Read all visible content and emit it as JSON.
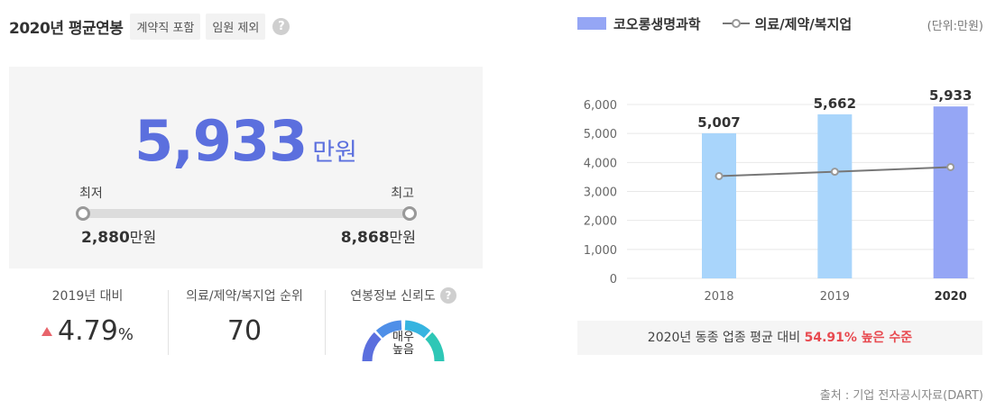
{
  "header": {
    "title": "2020년 평균연봉",
    "tags": [
      "계약직 포함",
      "임원 제외"
    ],
    "help_icon": "?"
  },
  "salary": {
    "value": "5,933",
    "unit": "만원",
    "min_label": "최저",
    "max_label": "최고",
    "min_value": "2,880",
    "max_value": "8,868",
    "value_unit": "만원"
  },
  "stats": {
    "growth_label": "2019년 대비",
    "growth_value": "4.79",
    "growth_pct": "%",
    "rank_label": "의료/제약/복지업 순위",
    "rank_value": "70",
    "reliability_label": "연봉정보 신뢰도",
    "reliability_line1": "매우",
    "reliability_line2": "높음"
  },
  "legend": {
    "company": "코오롱생명과학",
    "industry": "의료/제약/복지업",
    "unit": "(단위:만원)"
  },
  "chart_data": {
    "type": "bar",
    "categories": [
      "2018",
      "2019",
      "2020"
    ],
    "series": [
      {
        "name": "코오롱생명과학",
        "values": [
          5007,
          5662,
          5933
        ],
        "labels": [
          "5,007",
          "5,662",
          "5,933"
        ]
      },
      {
        "name": "의료/제약/복지업",
        "type": "line",
        "values": [
          3530,
          3680,
          3840
        ]
      }
    ],
    "yticks": [
      "6,000",
      "5,000",
      "4,000",
      "3,000",
      "2,000",
      "1,000",
      "0"
    ],
    "ylim": [
      0,
      6000
    ],
    "colors": {
      "bar": "#a9d5fb",
      "bar_highlight": "#95a6f5",
      "line": "#777777"
    },
    "highlight_index": 2
  },
  "compare": {
    "prefix": "2020년 동종 업종 평균 대비 ",
    "highlight": "54.91% 높은 수준"
  },
  "source": "출처 : 기업 전자공시자료(DART)",
  "colors": {
    "accent": "#5b6fde",
    "up": "#e8646b"
  }
}
